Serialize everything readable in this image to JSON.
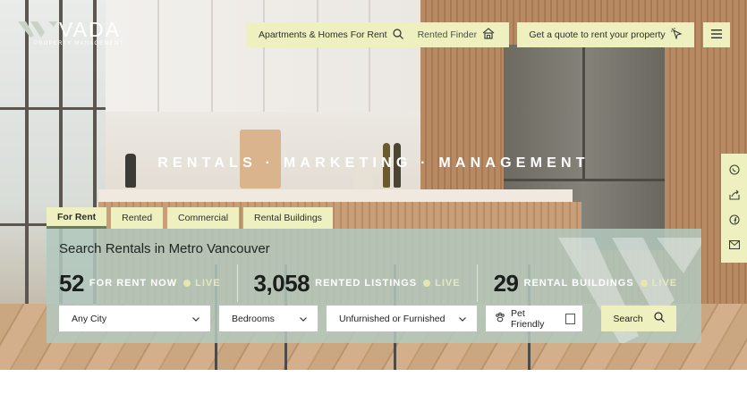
{
  "brand": {
    "name": "VADA",
    "subtitle": "PROPERTY MANAGEMENT",
    "icon": "vada-logo-icon"
  },
  "nav": {
    "apartments_label": "Apartments & Homes For Rent",
    "apartments_icon": "search-icon",
    "rented_finder_label": "Rented Finder",
    "rented_finder_icon": "home-icon",
    "quote_label": "Get a quote to rent your property",
    "quote_icon": "sparkle-pointer-icon",
    "menu_icon": "hamburger-menu-icon"
  },
  "tagline": "RENTALS · MARKETING · MANAGEMENT",
  "share": {
    "icons": [
      "whatsapp-icon",
      "share-icon",
      "facebook-icon",
      "email-icon"
    ]
  },
  "tabs": [
    {
      "label": "For Rent",
      "active": true
    },
    {
      "label": "Rented",
      "active": false
    },
    {
      "label": "Commercial",
      "active": false
    },
    {
      "label": "Rental Buildings",
      "active": false
    }
  ],
  "search": {
    "title": "Search Rentals in Metro Vancouver",
    "stats": [
      {
        "value": "52",
        "label": "FOR RENT NOW",
        "live": "LIVE"
      },
      {
        "value": "3,058",
        "label": "RENTED LISTINGS",
        "live": "LIVE"
      },
      {
        "value": "29",
        "label": "RENTAL BUILDINGS",
        "live": "LIVE"
      }
    ],
    "filters": {
      "city": "Any City",
      "bedrooms": "Bedrooms",
      "furnished": "Unfurnished or Furnished",
      "pet_label": "Pet Friendly",
      "pet_checked": false
    },
    "button_label": "Search",
    "button_icon": "search-icon"
  },
  "colors": {
    "accent": "#eef0bf",
    "panel": "#b2c8be",
    "text_dark": "#1f2421"
  }
}
